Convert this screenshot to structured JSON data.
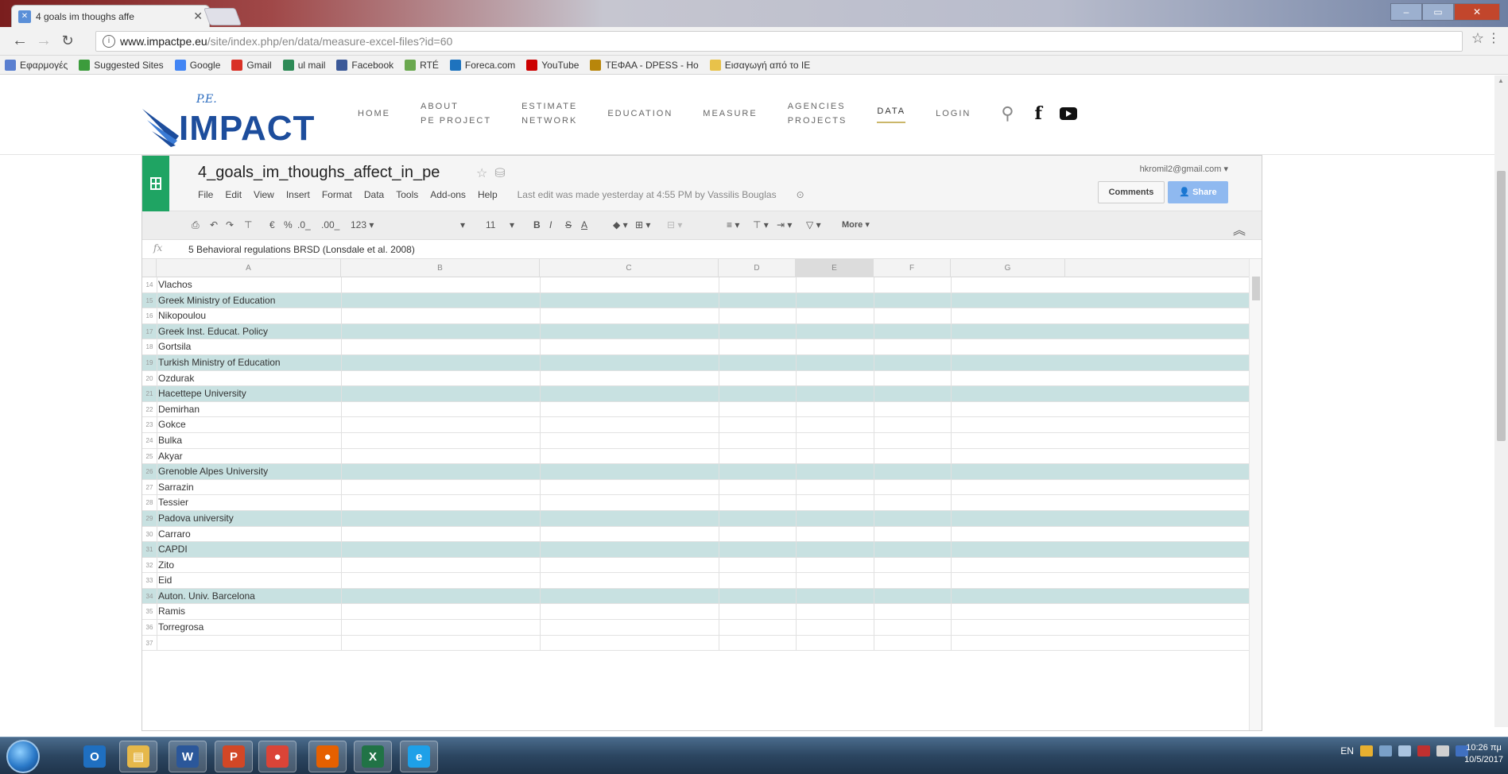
{
  "browser": {
    "tab_title": "4 goals im thoughs affe",
    "url_host": "www.impactpe.eu",
    "url_path": "/site/index.php/en/data/measure-excel-files?id=60",
    "bookmarks": [
      {
        "label": "Εφαρμογές",
        "icon": "apps-icon",
        "color": "#5a7fd0"
      },
      {
        "label": "Suggested Sites",
        "icon": "suggested-sites-icon",
        "color": "#3c9c3c"
      },
      {
        "label": "Google",
        "icon": "google-icon",
        "color": "#4285f4"
      },
      {
        "label": "Gmail",
        "icon": "gmail-icon",
        "color": "#d93025"
      },
      {
        "label": "ul mail",
        "icon": "ul-mail-icon",
        "color": "#2e8b57"
      },
      {
        "label": "Facebook",
        "icon": "facebook-icon",
        "color": "#3b5998"
      },
      {
        "label": "RTÉ",
        "icon": "rte-icon",
        "color": "#6aa84f"
      },
      {
        "label": "Foreca.com",
        "icon": "foreca-icon",
        "color": "#1e73be"
      },
      {
        "label": "YouTube",
        "icon": "youtube-icon",
        "color": "#cc0000"
      },
      {
        "label": "ΤΕΦΑΑ - DPESS - Ho",
        "icon": "dpess-icon",
        "color": "#b8860b"
      },
      {
        "label": "Εισαγωγή από το IE",
        "icon": "folder-icon",
        "color": "#e8c24a"
      }
    ]
  },
  "site": {
    "logo_small": "P.E.",
    "logo_text": "IMPACT",
    "nav": [
      {
        "l1": "HOME",
        "l2": ""
      },
      {
        "l1": "ABOUT",
        "l2": "PE PROJECT"
      },
      {
        "l1": "ESTIMATE",
        "l2": "NETWORK"
      },
      {
        "l1": "EDUCATION",
        "l2": ""
      },
      {
        "l1": "MEASURE",
        "l2": ""
      },
      {
        "l1": "AGENCIES",
        "l2": "PROJECTS"
      },
      {
        "l1": "DATA",
        "l2": ""
      },
      {
        "l1": "LOGIN",
        "l2": ""
      }
    ],
    "active_nav": "DATA"
  },
  "sheet": {
    "title": "4_goals_im_thoughs_affect_in_pe",
    "user": "hkromil2@gmail.com",
    "menus": [
      "File",
      "Edit",
      "View",
      "Insert",
      "Format",
      "Data",
      "Tools",
      "Add-ons",
      "Help"
    ],
    "last_edit": "Last edit was made yesterday at 4:55 PM by Vassilis Bouglas",
    "comments_label": "Comments",
    "share_label": "Share",
    "format_bar": {
      "currency": "€",
      "percent": "%",
      "dec_less": ".0_",
      "dec_more": ".00_",
      "num_fmt": "123 ▾",
      "font_size": "11",
      "more": "More ▾"
    },
    "formula_value": "5 Behavioral regulations BRSD (Lonsdale et al. 2008)",
    "columns": [
      "A",
      "B",
      "C",
      "D",
      "E",
      "F",
      "G"
    ],
    "rows": [
      {
        "num": "14",
        "a": "Vlachos",
        "hl": false
      },
      {
        "num": "15",
        "a": "Greek Ministry of Education",
        "hl": true
      },
      {
        "num": "16",
        "a": "Nikopoulou",
        "hl": false
      },
      {
        "num": "17",
        "a": "Greek Inst. Educat. Policy",
        "hl": true
      },
      {
        "num": "18",
        "a": "Gortsila",
        "hl": false
      },
      {
        "num": "19",
        "a": "Turkish Ministry of Education",
        "hl": true
      },
      {
        "num": "20",
        "a": "Ozdurak",
        "hl": false
      },
      {
        "num": "21",
        "a": "Hacettepe University",
        "hl": true
      },
      {
        "num": "22",
        "a": "Demirhan",
        "hl": false
      },
      {
        "num": "23",
        "a": "Gokce",
        "hl": false
      },
      {
        "num": "24",
        "a": "Bulka",
        "hl": false
      },
      {
        "num": "25",
        "a": "Akyar",
        "hl": false
      },
      {
        "num": "26",
        "a": "Grenoble Alpes University",
        "hl": true
      },
      {
        "num": "27",
        "a": "Sarrazin",
        "hl": false
      },
      {
        "num": "28",
        "a": "Tessier",
        "hl": false
      },
      {
        "num": "29",
        "a": "Padova university",
        "hl": true
      },
      {
        "num": "30",
        "a": "Carraro",
        "hl": false
      },
      {
        "num": "31",
        "a": "CAPDI",
        "hl": true
      },
      {
        "num": "32",
        "a": "Zito",
        "hl": false
      },
      {
        "num": "33",
        "a": "Eid",
        "hl": false
      },
      {
        "num": "34",
        "a": "Auton. Univ. Barcelona",
        "hl": true
      },
      {
        "num": "35",
        "a": "Ramis",
        "hl": false
      },
      {
        "num": "36",
        "a": "Torregrosa",
        "hl": false
      },
      {
        "num": "37",
        "a": "",
        "hl": false
      }
    ]
  },
  "taskbar": {
    "apps": [
      {
        "name": "outlook-icon",
        "glyph": "O",
        "color": "#1f6fc0"
      },
      {
        "name": "explorer-icon",
        "glyph": "▤",
        "color": "#e6b84a"
      },
      {
        "name": "word-icon",
        "glyph": "W",
        "color": "#2b579a"
      },
      {
        "name": "powerpoint-icon",
        "glyph": "P",
        "color": "#d24726"
      },
      {
        "name": "chrome-icon",
        "glyph": "●",
        "color": "#db4437"
      },
      {
        "name": "firefox-icon",
        "glyph": "●",
        "color": "#e66000"
      },
      {
        "name": "excel-icon",
        "glyph": "X",
        "color": "#217346"
      },
      {
        "name": "ie-icon",
        "glyph": "e",
        "color": "#1ea0e8"
      }
    ],
    "lang": "EN",
    "time": "10:26 πμ",
    "date": "10/5/2017"
  }
}
